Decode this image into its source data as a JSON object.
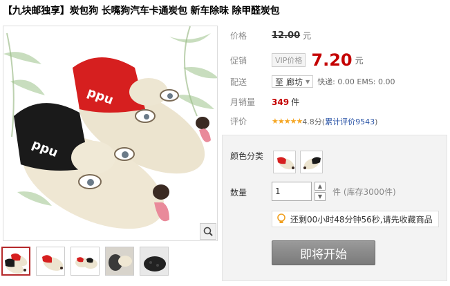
{
  "product": {
    "title": "【九块邮独享】炭包狗 长嘴狗汽车卡通炭包 新车除味 除甲醛炭包"
  },
  "price": {
    "label": "价格",
    "original": "12.00",
    "unit": "元"
  },
  "promo": {
    "label": "促销",
    "badge": "VIP价格",
    "price": "7.20",
    "unit": "元"
  },
  "shipping": {
    "label": "配送",
    "from": "至",
    "city": "廊坊",
    "info": "快递: 0.00 EMS: 0.00"
  },
  "sales": {
    "label": "月销量",
    "count": "349",
    "unit": "件"
  },
  "review": {
    "label": "评价",
    "stars": "★★★★★",
    "score": "4.8分(",
    "link": "累计评价9543",
    "close": ")"
  },
  "sku": {
    "color_label": "颜色分类",
    "quantity_label": "数量",
    "quantity_value": "1",
    "stock_note": "件 (库存3000件)"
  },
  "timer": {
    "text": "还剩00小时48分钟56秒,请先收藏商品"
  },
  "action": {
    "button": "即将开始"
  },
  "colors": {
    "accent": "#c40000",
    "link": "#2953a6",
    "star": "#f5a623",
    "thumb_active": "#b5292b"
  }
}
